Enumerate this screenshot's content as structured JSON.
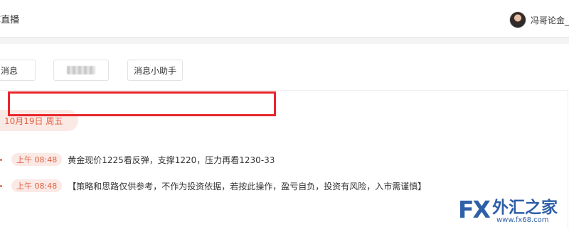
{
  "header": {
    "app_title": "C直播",
    "user_name": "冯哥论金_"
  },
  "tabs": [
    {
      "label": "消息"
    },
    {
      "label": ""
    },
    {
      "label": "消息小助手"
    }
  ],
  "feed": {
    "date_label": "10月19日 周五",
    "messages": [
      {
        "time": "上午 08:48",
        "text": "黄金现价1225看反弹，支撑1220，压力再看1230-33",
        "highlighted": true
      },
      {
        "time": "上午 08:48",
        "text": "【策略和思路仅供参考，不作为投资依据，若按此操作，盈亏自负，投资有风险，入市需谨慎】",
        "highlighted": false
      }
    ]
  },
  "watermark": {
    "brand": "FX",
    "name": "外汇之家",
    "url": "www.fx68.com"
  },
  "colors": {
    "accent": "#e0613f",
    "highlight_box": "#e8262c",
    "logo": "#2f5fa8"
  }
}
